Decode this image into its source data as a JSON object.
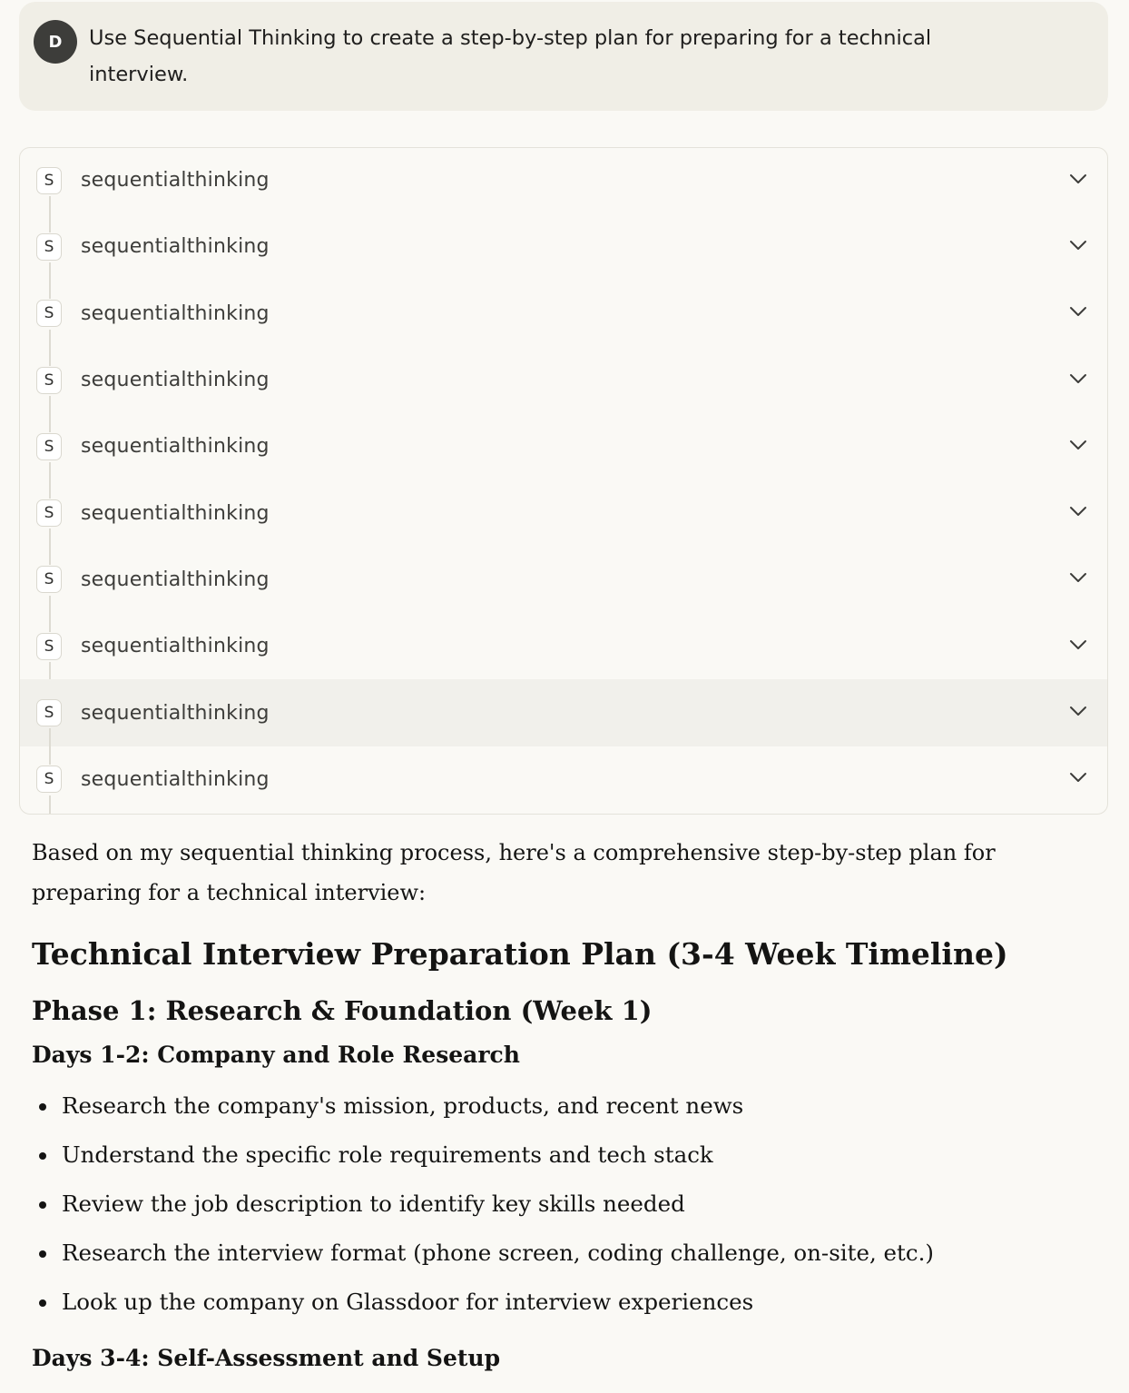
{
  "user_message": {
    "avatar_initial": "D",
    "text": "Use Sequential Thinking to create a step-by-step plan for preparing for a technical interview."
  },
  "tool_calls": [
    {
      "badge": "S",
      "label": "sequentialthinking"
    },
    {
      "badge": "S",
      "label": "sequentialthinking"
    },
    {
      "badge": "S",
      "label": "sequentialthinking"
    },
    {
      "badge": "S",
      "label": "sequentialthinking"
    },
    {
      "badge": "S",
      "label": "sequentialthinking"
    },
    {
      "badge": "S",
      "label": "sequentialthinking"
    },
    {
      "badge": "S",
      "label": "sequentialthinking"
    },
    {
      "badge": "S",
      "label": "sequentialthinking"
    },
    {
      "badge": "S",
      "label": "sequentialthinking"
    },
    {
      "badge": "S",
      "label": "sequentialthinking"
    }
  ],
  "response": {
    "intro": "Based on my sequential thinking process, here's a comprehensive step-by-step plan for preparing for a technical interview:",
    "title": "Technical Interview Preparation Plan (3-4 Week Timeline)",
    "phase1": {
      "heading": "Phase 1: Research & Foundation (Week 1)",
      "section1": {
        "heading": "Days 1-2: Company and Role Research",
        "bullets": [
          "Research the company's mission, products, and recent news",
          "Understand the specific role requirements and tech stack",
          "Review the job description to identify key skills needed",
          "Research the interview format (phone screen, coding challenge, on-site, etc.)",
          "Look up the company on Glassdoor for interview experiences"
        ]
      },
      "section2": {
        "heading": "Days 3-4: Self-Assessment and Setup"
      }
    }
  },
  "colors": {
    "background": "#faf9f5",
    "user_bubble": "#f0eee6",
    "avatar": "#3d3d3a",
    "border": "#e4e2da",
    "hover_row": "#f1f0eb"
  }
}
